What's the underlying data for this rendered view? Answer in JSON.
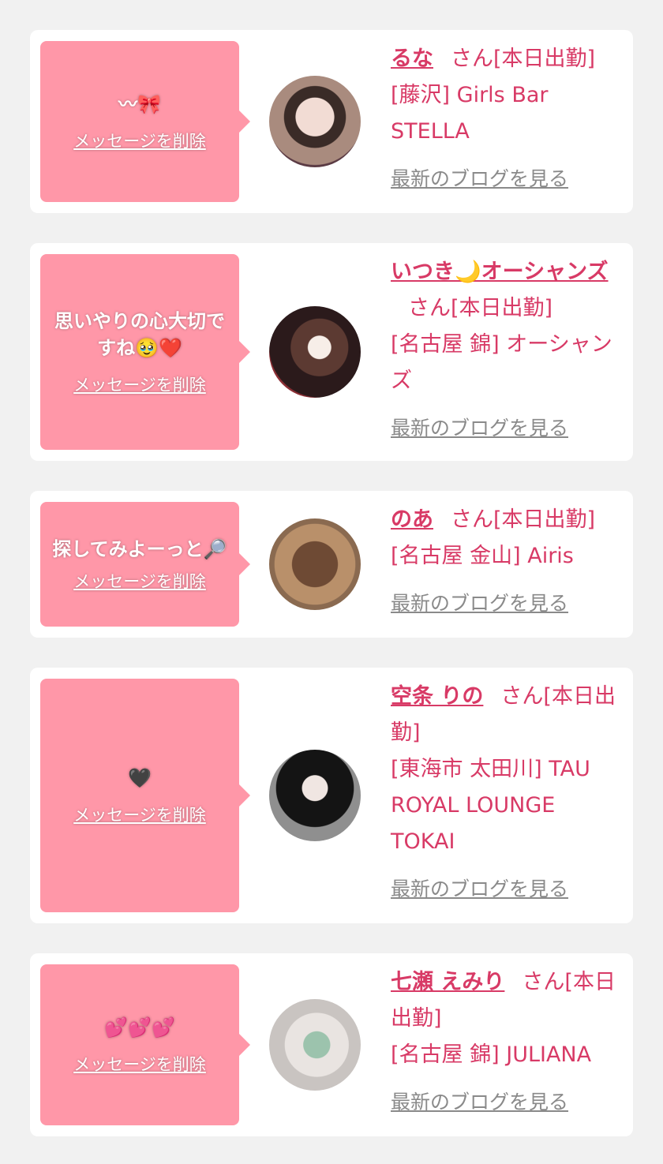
{
  "common": {
    "delete_label": "メッセージを削除",
    "blog_label": "最新のブログを見る",
    "san_label": "さん[本日出勤]"
  },
  "cards": [
    {
      "message": "〰︎🎀",
      "name": "るな",
      "area": "[藤沢] Girls Bar STELLA"
    },
    {
      "message": "思いやりの心大切ですね🥹❤️",
      "name": "いつき🌙オーシャンズ",
      "area": "[名古屋 錦] オーシャンズ"
    },
    {
      "message": "探してみよーっと🔎",
      "name": "のあ",
      "area": "[名古屋 金山] Airis"
    },
    {
      "message": "🖤",
      "name": "空条 りの",
      "area": "[東海市 太田川] TAU ROYAL LOUNGE TOKAI"
    },
    {
      "message": "💕💕💕",
      "name": "七瀬 えみり",
      "area": "[名古屋 錦] JULIANA"
    }
  ],
  "colors": {
    "bubble": "#ff97a8",
    "name": "#d83a66",
    "link_gray": "#8a8a8a",
    "background": "#f1f1f1"
  }
}
